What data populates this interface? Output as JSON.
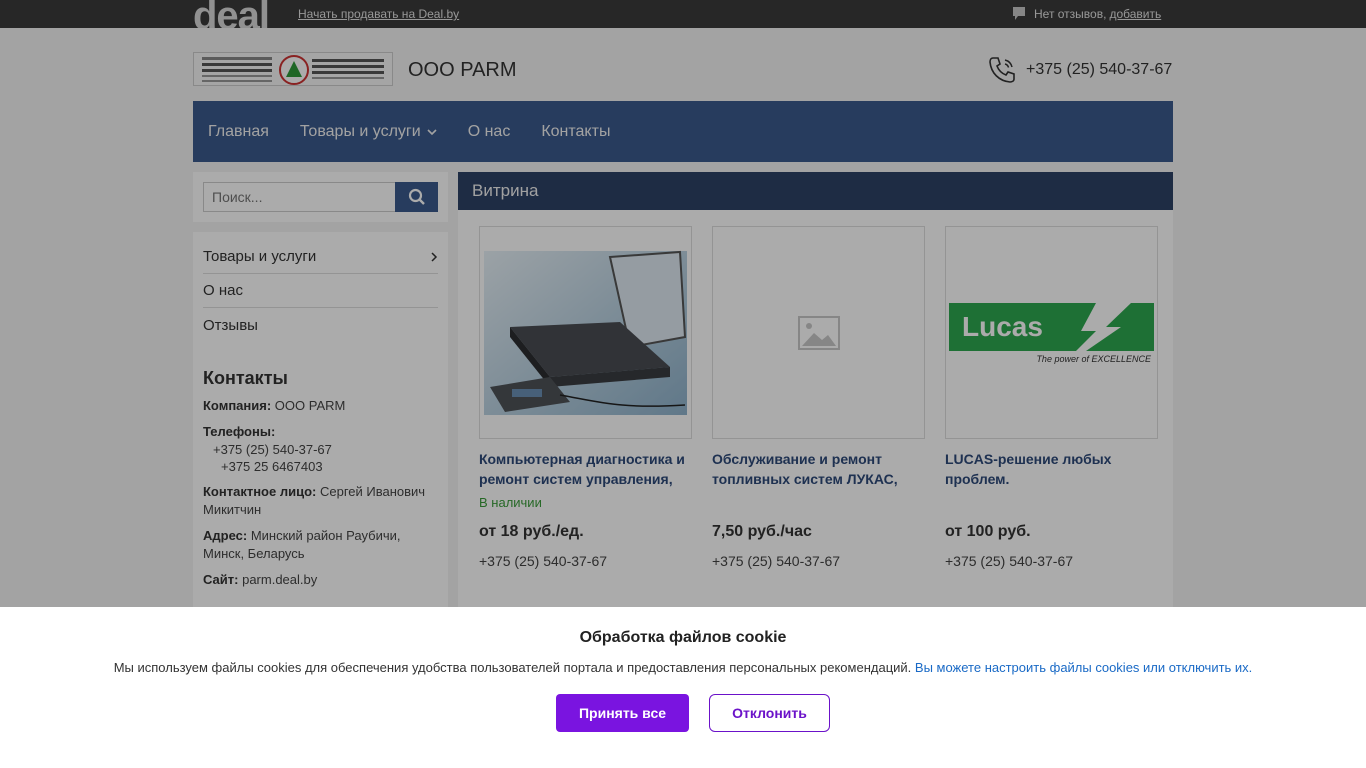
{
  "topbar": {
    "logo_text": "deal",
    "sell_link": "Начать продавать на Deal.by",
    "reviews_text": "Нет отзывов,",
    "reviews_add": "добавить"
  },
  "header": {
    "company_name": "ООО PARM",
    "phone": "+375 (25) 540-37-67"
  },
  "nav": {
    "items": [
      "Главная",
      "Товары и услуги",
      "О нас",
      "Контакты"
    ]
  },
  "search": {
    "placeholder": "Поиск..."
  },
  "sidebar": {
    "items": [
      "Товары и услуги",
      "О нас",
      "Отзывы"
    ],
    "contacts_title": "Контакты",
    "company_label": "Компания:",
    "company_value": "ООО PARM",
    "phones_label": "Телефоны:",
    "phones": [
      "+375 (25) 540-37-67",
      "+375 25 6467403"
    ],
    "person_label": "Контактное лицо:",
    "person_value": "Сергей Иванович Микитчин",
    "address_label": "Адрес:",
    "address_value": "Минский район Раубичи, Минск, Беларусь",
    "site_label": "Сайт:",
    "site_value": "parm.deal.by"
  },
  "main": {
    "title": "Витрина",
    "products": [
      {
        "title": "Компьютерная диагностика и ремонт систем управления,",
        "stock": "В наличии",
        "price": "от 18 руб./ед.",
        "phone": "+375 (25) 540-37-67"
      },
      {
        "title": "Обслуживание и ремонт топливных систем ЛУКАС,",
        "stock": "",
        "price": "7,50 руб./час",
        "phone": "+375 (25) 540-37-67"
      },
      {
        "title": "LUCAS-решение любых проблем.",
        "stock": "",
        "price": "от 100 руб.",
        "phone": "+375 (25) 540-37-67"
      }
    ],
    "lucas_logo": "Lucas",
    "lucas_slogan": "The power of EXCELLENCE"
  },
  "cookie": {
    "title": "Обработка файлов cookie",
    "text": "Мы используем файлы cookies для обеспечения удобства пользователей портала и предоставления персональных рекомендаций.",
    "link": "Вы можете настроить файлы cookies или отключить их.",
    "accept": "Принять все",
    "decline": "Отклонить"
  },
  "colors": {
    "nav": "#3b5a8c",
    "accent": "#7a14e0",
    "title_link": "#2e4a7a",
    "stock": "#3a9c3a"
  }
}
